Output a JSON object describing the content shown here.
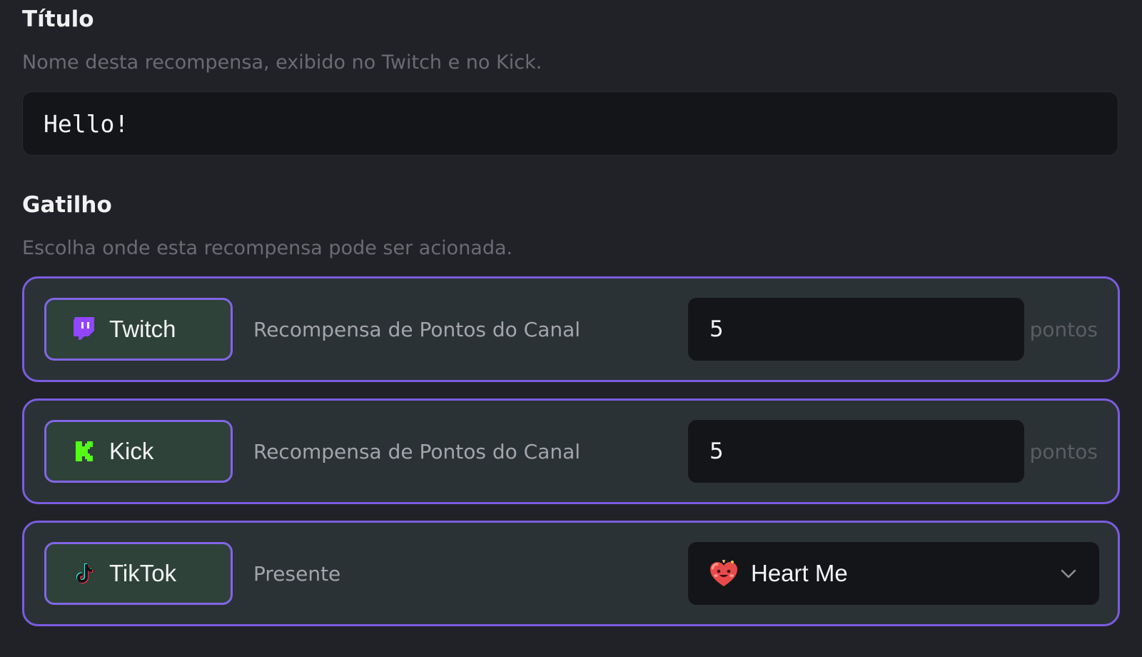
{
  "title_section": {
    "heading": "Título",
    "description": "Nome desta recompensa, exibido no Twitch e no Kick.",
    "value": "Hello!"
  },
  "trigger_section": {
    "heading": "Gatilho",
    "description": "Escolha onde esta recompensa pode ser acionada.",
    "rows": [
      {
        "platform": "Twitch",
        "icon": "twitch-icon",
        "type": "Recompensa de Pontos do Canal",
        "points": "5",
        "unit": "pontos"
      },
      {
        "platform": "Kick",
        "icon": "kick-icon",
        "type": "Recompensa de Pontos do Canal",
        "points": "5",
        "unit": "pontos"
      },
      {
        "platform": "TikTok",
        "icon": "tiktok-icon",
        "type": "Presente",
        "gift": "Heart Me",
        "gift_icon": "heart-me-gift-icon"
      }
    ]
  },
  "colors": {
    "background": "#212227",
    "row_background": "#2a3235",
    "accent_border": "#7b5ce0",
    "input_background": "#141519",
    "twitch": "#9146ff",
    "kick": "#53fc18"
  }
}
